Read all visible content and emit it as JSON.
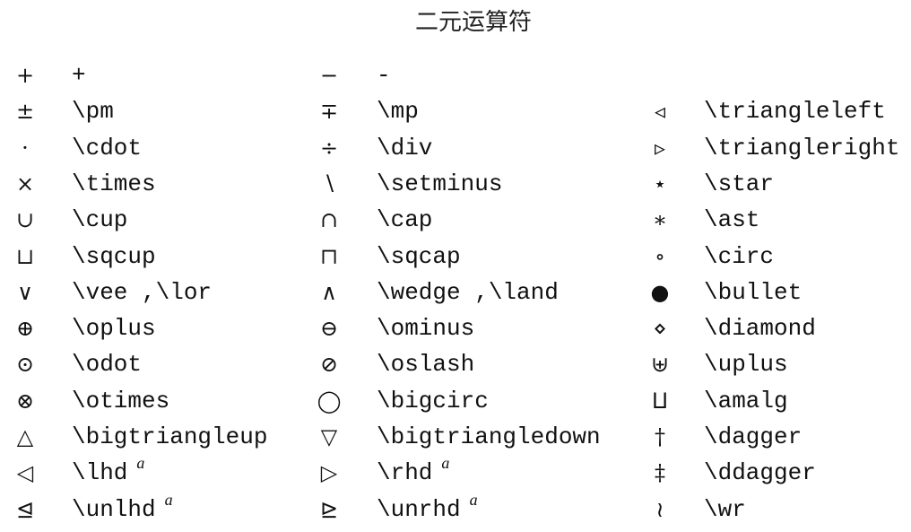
{
  "title": "二元运算符",
  "footnote_mark": "a",
  "rows": [
    [
      {
        "sym": "+",
        "cmd": "+"
      },
      {
        "sym": "−",
        "cmd": "-"
      },
      null
    ],
    [
      {
        "sym": "±",
        "cmd": "\\pm"
      },
      {
        "sym": "∓",
        "cmd": "\\mp"
      },
      {
        "sym": "◃",
        "cmd": "\\triangleleft"
      }
    ],
    [
      {
        "sym": "·",
        "cmd": "\\cdot"
      },
      {
        "sym": "÷",
        "cmd": "\\div"
      },
      {
        "sym": "▹",
        "cmd": "\\triangleright"
      }
    ],
    [
      {
        "sym": "×",
        "cmd": "\\times"
      },
      {
        "sym": "∖",
        "cmd": "\\setminus"
      },
      {
        "sym": "⋆",
        "cmd": "\\star"
      }
    ],
    [
      {
        "sym": "∪",
        "cmd": "\\cup"
      },
      {
        "sym": "∩",
        "cmd": "\\cap"
      },
      {
        "sym": "∗",
        "cmd": "\\ast"
      }
    ],
    [
      {
        "sym": "⊔",
        "cmd": "\\sqcup"
      },
      {
        "sym": "⊓",
        "cmd": "\\sqcap"
      },
      {
        "sym": "∘",
        "cmd": "\\circ"
      }
    ],
    [
      {
        "sym": "∨",
        "cmd": "\\vee ,\\lor"
      },
      {
        "sym": "∧",
        "cmd": "\\wedge ,\\land"
      },
      {
        "sym": "●",
        "cmd": "\\bullet"
      }
    ],
    [
      {
        "sym": "⊕",
        "cmd": "\\oplus"
      },
      {
        "sym": "⊖",
        "cmd": "\\ominus"
      },
      {
        "sym": "⋄",
        "cmd": "\\diamond"
      }
    ],
    [
      {
        "sym": "⊙",
        "cmd": "\\odot"
      },
      {
        "sym": "⊘",
        "cmd": "\\oslash"
      },
      {
        "sym": "⊎",
        "cmd": "\\uplus"
      }
    ],
    [
      {
        "sym": "⊗",
        "cmd": "\\otimes"
      },
      {
        "sym": "◯",
        "cmd": "\\bigcirc"
      },
      {
        "sym": "⨿",
        "cmd": "\\amalg"
      }
    ],
    [
      {
        "sym": "△",
        "cmd": "\\bigtriangleup"
      },
      {
        "sym": "▽",
        "cmd": "\\bigtriangledown"
      },
      {
        "sym": "†",
        "cmd": "\\dagger"
      }
    ],
    [
      {
        "sym": "◁",
        "cmd": "\\lhd",
        "note": true
      },
      {
        "sym": "▷",
        "cmd": "\\rhd",
        "note": true
      },
      {
        "sym": "‡",
        "cmd": "\\ddagger"
      }
    ],
    [
      {
        "sym": "⊴",
        "cmd": "\\unlhd",
        "note": true
      },
      {
        "sym": "⊵",
        "cmd": "\\unrhd",
        "note": true
      },
      {
        "sym": "≀",
        "cmd": "\\wr"
      }
    ]
  ]
}
